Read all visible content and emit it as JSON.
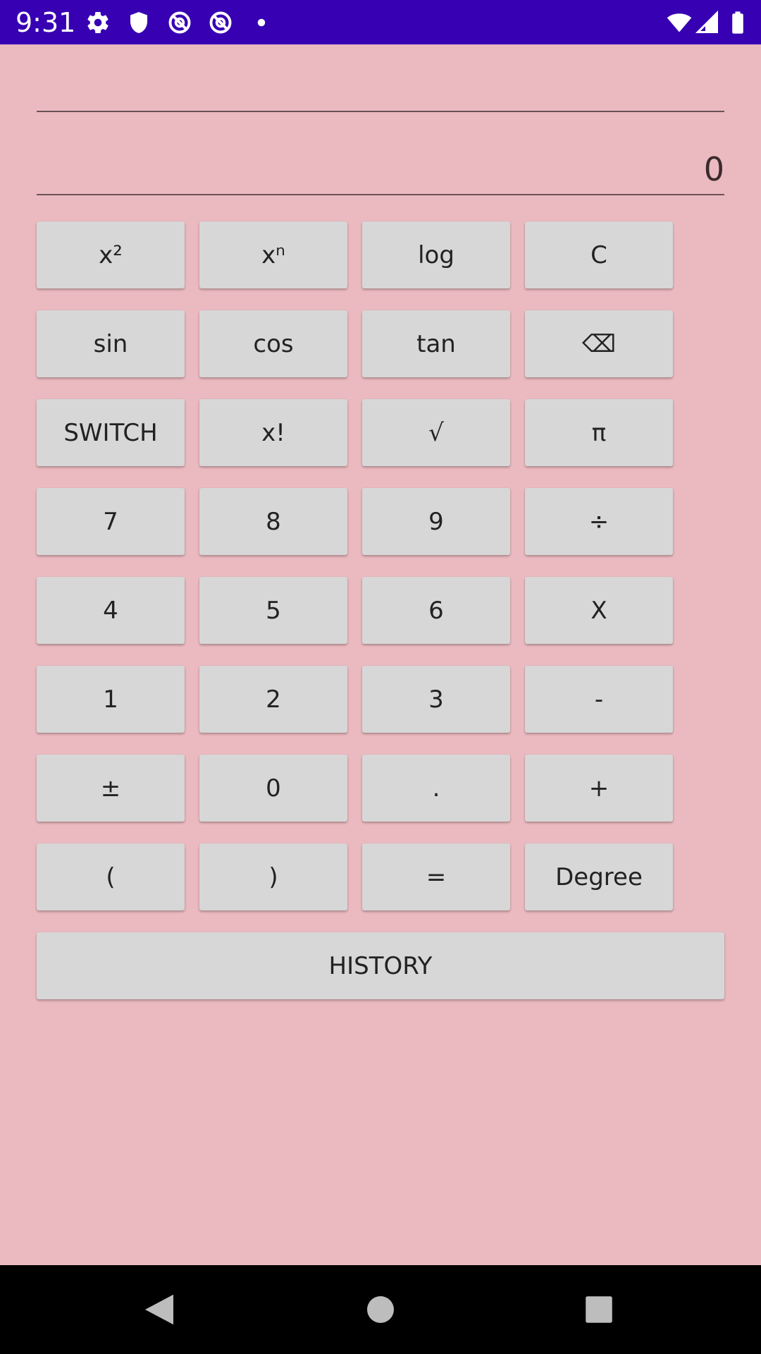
{
  "status_bar": {
    "time": "9:31",
    "icons_left": [
      "gear-icon",
      "shield-icon",
      "no-sync-icon",
      "no-sync-icon",
      "dot-icon"
    ],
    "icons_right": [
      "wifi-icon",
      "signal-icon",
      "battery-icon"
    ],
    "background_color": "#3700B3"
  },
  "display": {
    "expression": "",
    "result": "0"
  },
  "keypad": {
    "rows": [
      [
        "x²",
        "xⁿ",
        "log",
        "C"
      ],
      [
        "sin",
        "cos",
        "tan",
        "⌫"
      ],
      [
        "SWITCH",
        "x!",
        "√",
        "π"
      ],
      [
        "7",
        "8",
        "9",
        "÷"
      ],
      [
        "4",
        "5",
        "6",
        "X"
      ],
      [
        "1",
        "2",
        "3",
        "-"
      ],
      [
        "±",
        "0",
        ".",
        "+"
      ],
      [
        "(",
        ")",
        "=",
        "Degree"
      ]
    ],
    "history_label": "HISTORY"
  },
  "theme": {
    "background": "#EBBAC0",
    "button": "#D7D7D7"
  },
  "nav_bar": {
    "icons": [
      "back-icon",
      "home-icon",
      "recents-icon"
    ]
  }
}
